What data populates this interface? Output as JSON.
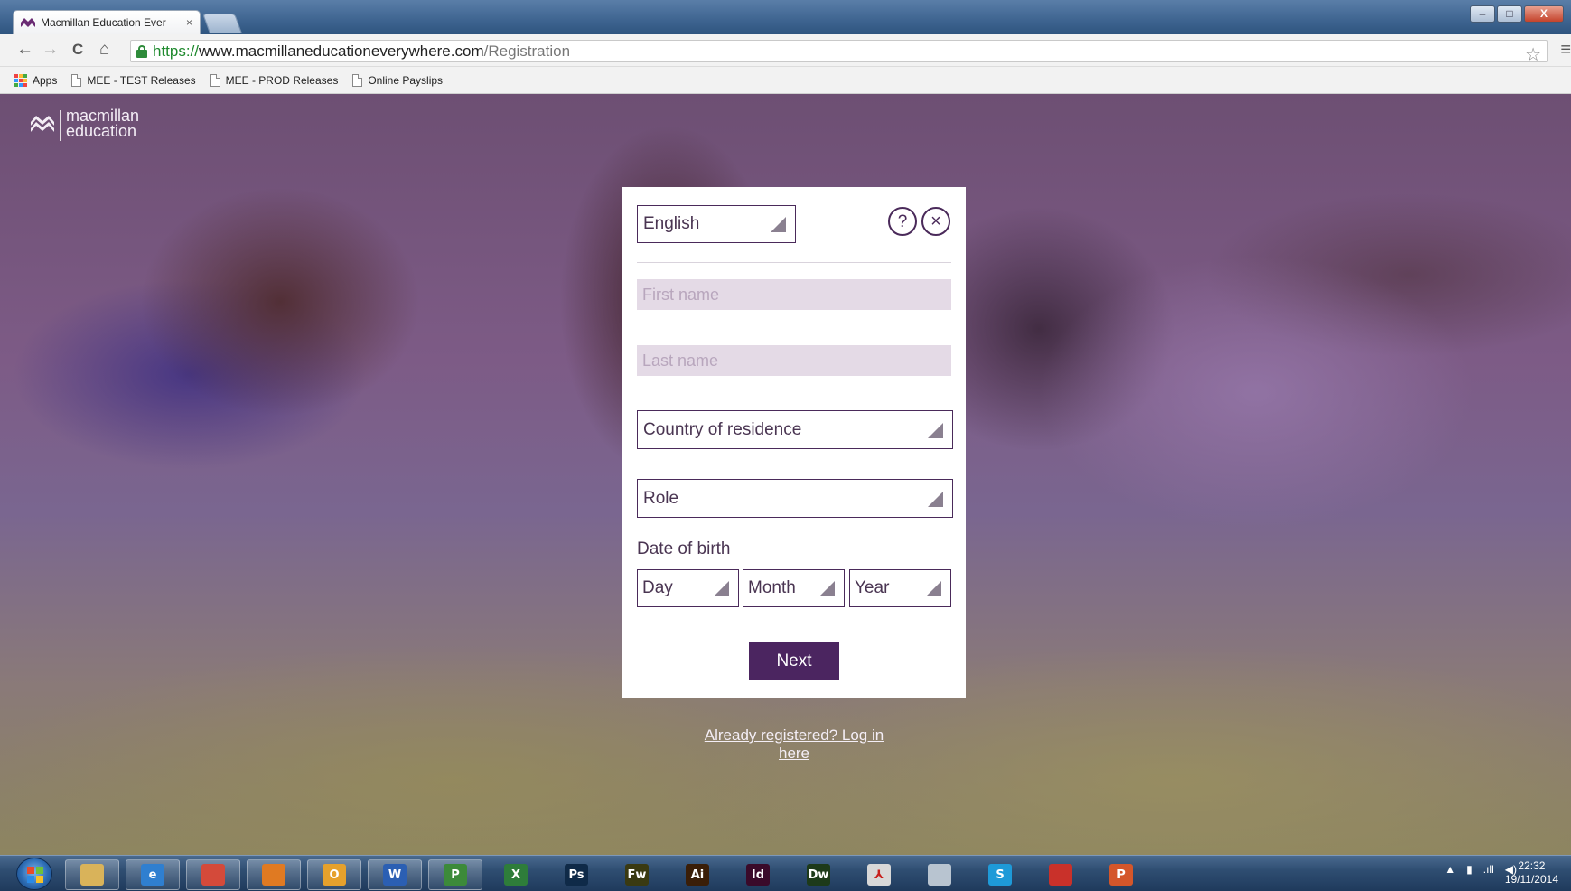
{
  "browser": {
    "tab_title": "Macmillan Education Ever",
    "tab_close": "×",
    "url_scheme": "https://",
    "url_host": "www.macmillaneducationeverywhere.com",
    "url_path": "/Registration",
    "bookmarks": [
      {
        "label": "Apps",
        "icon": "apps-grid-icon"
      },
      {
        "label": "MEE - TEST Releases",
        "icon": "page-icon"
      },
      {
        "label": "MEE - PROD Releases",
        "icon": "page-icon"
      },
      {
        "label": "Online Payslips",
        "icon": "page-icon"
      }
    ],
    "nav_icons": {
      "back": "←",
      "forward": "→",
      "reload": "C",
      "home": "⌂",
      "star": "☆",
      "menu": "≡"
    },
    "window_controls": {
      "minimize": "–",
      "maximize": "□",
      "close": "X"
    }
  },
  "page": {
    "logo_line1": "macmillan",
    "logo_line2": "education",
    "form": {
      "language": "English",
      "help_icon": "?",
      "close_icon": "×",
      "first_name_placeholder": "First name",
      "last_name_placeholder": "Last name",
      "country_placeholder": "Country of residence",
      "role_placeholder": "Role",
      "dob_label": "Date of birth",
      "day_placeholder": "Day",
      "month_placeholder": "Month",
      "year_placeholder": "Year",
      "next_label": "Next"
    },
    "login_link": "Already registered? Log in here"
  },
  "taskbar": {
    "apps": [
      {
        "name": "explorer",
        "label": "",
        "color": "#d9b35a"
      },
      {
        "name": "internet-explorer",
        "label": "e",
        "color": "#2f7fd0"
      },
      {
        "name": "chrome",
        "label": "",
        "color": "#d44a3a"
      },
      {
        "name": "firefox",
        "label": "",
        "color": "#e07a22"
      },
      {
        "name": "outlook",
        "label": "O",
        "color": "#e6a12c"
      },
      {
        "name": "word",
        "label": "W",
        "color": "#2b5fb3"
      },
      {
        "name": "project",
        "label": "P",
        "color": "#3c8a3a"
      },
      {
        "name": "excel",
        "label": "X",
        "color": "#2e7d3a"
      },
      {
        "name": "photoshop",
        "label": "Ps",
        "color": "#0f2a48"
      },
      {
        "name": "fireworks",
        "label": "Fw",
        "color": "#3a3a12"
      },
      {
        "name": "illustrator",
        "label": "Ai",
        "color": "#3a1e08"
      },
      {
        "name": "indesign",
        "label": "Id",
        "color": "#3a0a2a"
      },
      {
        "name": "dreamweaver",
        "label": "Dw",
        "color": "#1d3a1a"
      },
      {
        "name": "acrobat",
        "label": "⅄",
        "color": "#d8d8d8"
      },
      {
        "name": "calculator",
        "label": "",
        "color": "#b8c4d0"
      },
      {
        "name": "skype",
        "label": "S",
        "color": "#1e9ad8"
      },
      {
        "name": "creative-cloud",
        "label": "",
        "color": "#c9312a"
      },
      {
        "name": "powerpoint",
        "label": "P",
        "color": "#d4562a"
      }
    ],
    "tray": {
      "arrow": "▲",
      "battery": "▮",
      "signal": ".ıll",
      "volume": "◀)"
    },
    "time": "22:32",
    "date": "19/11/2014"
  }
}
